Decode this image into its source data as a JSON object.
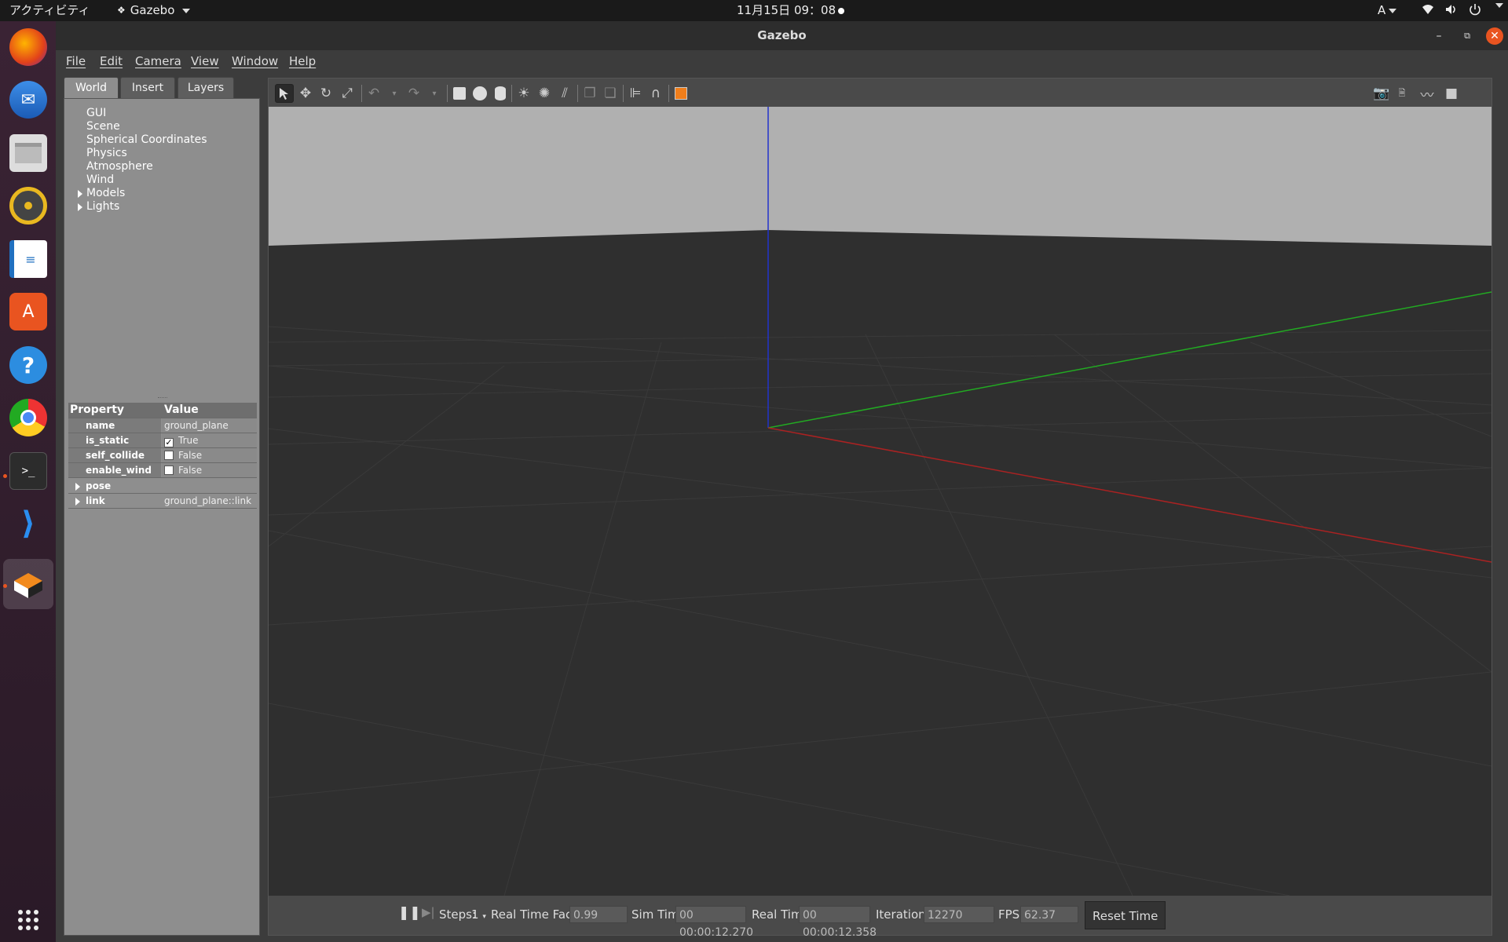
{
  "topbar": {
    "activities": "アクティビティ",
    "app_name": "Gazebo",
    "clock": "11月15日  09：08",
    "input_method": "A"
  },
  "dock": {
    "apps": [
      "firefox-icon",
      "thunderbird-icon",
      "files-icon",
      "rhythmbox-icon",
      "writer-icon",
      "app-center-icon",
      "help-icon",
      "chrome-icon",
      "terminal-icon",
      "vscode-icon",
      "gazebo-icon",
      "app-grid-icon"
    ]
  },
  "window": {
    "title": "Gazebo"
  },
  "menu": {
    "file": "File",
    "edit": "Edit",
    "camera": "Camera",
    "view": "View",
    "window": "Window",
    "help": "Help"
  },
  "tabs": {
    "world": "World",
    "insert": "Insert",
    "layers": "Layers"
  },
  "world_tree": {
    "gui": "GUI",
    "scene": "Scene",
    "spherical": "Spherical Coordinates",
    "physics": "Physics",
    "atmosphere": "Atmosphere",
    "wind": "Wind",
    "models": "Models",
    "lights": "Lights"
  },
  "properties": {
    "header_property": "Property",
    "header_value": "Value",
    "name_label": "name",
    "name_value": "ground_plane",
    "is_static_label": "is_static",
    "is_static_value": "True",
    "is_static_checked": true,
    "self_collide_label": "self_collide",
    "self_collide_value": "False",
    "self_collide_checked": false,
    "enable_wind_label": "enable_wind",
    "enable_wind_value": "False",
    "enable_wind_checked": false,
    "pose_label": "pose",
    "link_label": "link",
    "link_value": "ground_plane::link"
  },
  "bottombar": {
    "steps_label": "Steps:",
    "steps_value": "1",
    "rtf_label": "Real Time Factor:",
    "rtf_value": "0.99",
    "sim_time_label": "Sim Time:",
    "sim_time_value": "00 00:00:12.270",
    "real_time_label": "Real Time:",
    "real_time_value": "00 00:00:12.358",
    "iterations_label": "Iterations:",
    "iterations_value": "12270",
    "fps_label": "FPS:",
    "fps_value": "62.37",
    "reset_time": "Reset Time"
  }
}
